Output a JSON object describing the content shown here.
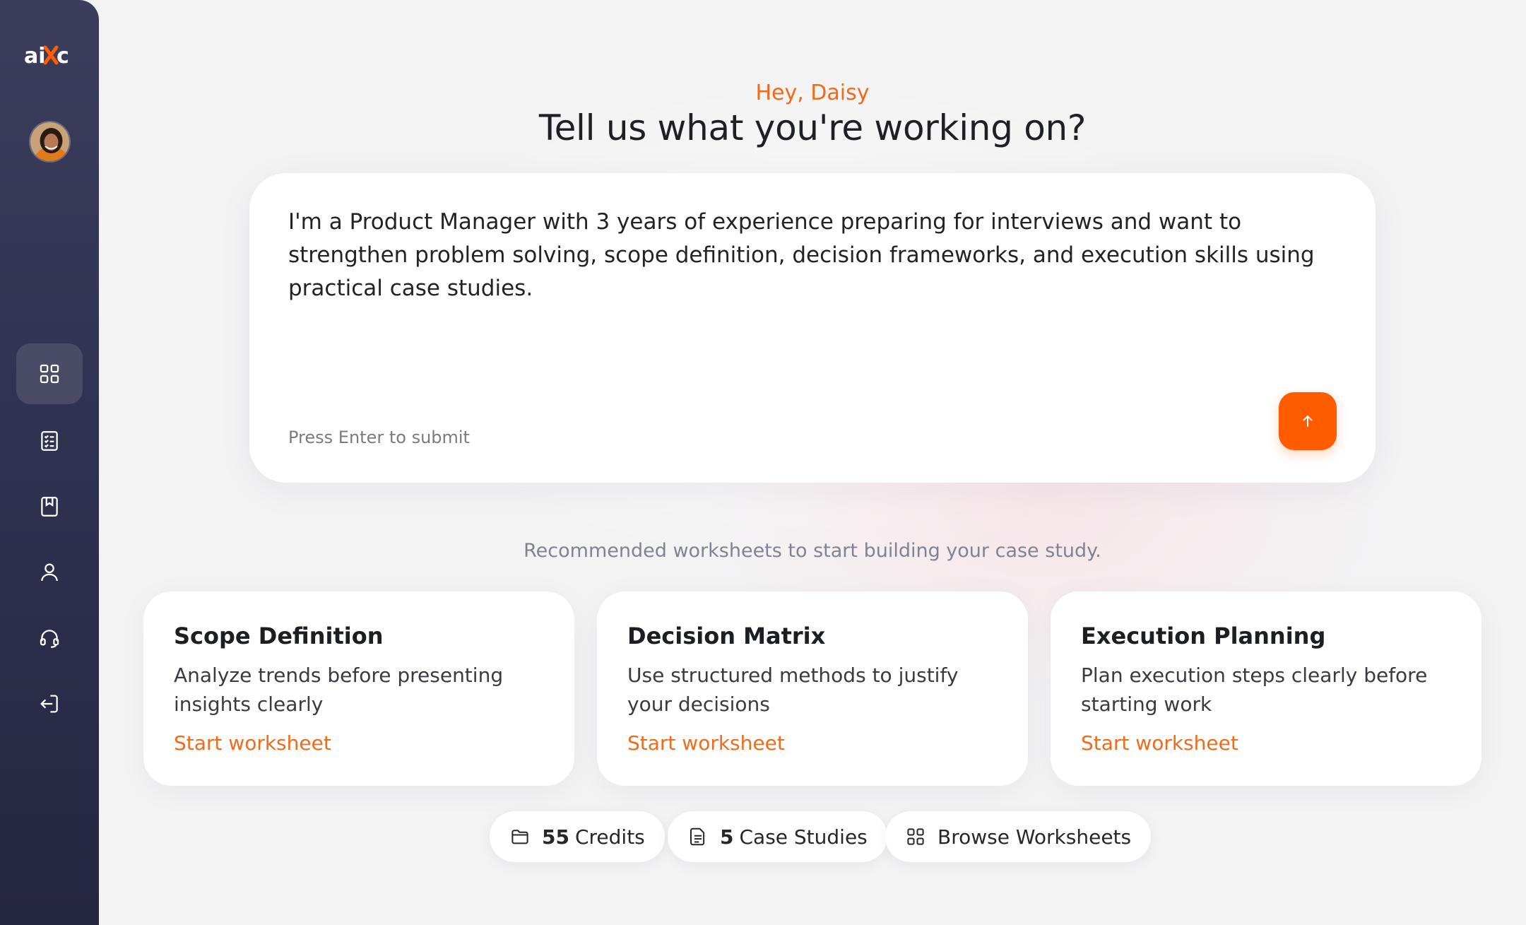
{
  "app": {
    "brand": "aixc"
  },
  "sidebar": {
    "items": [
      {
        "name": "dashboard",
        "icon": "grid-icon",
        "active": true
      },
      {
        "name": "checklist",
        "icon": "checklist-icon",
        "active": false
      },
      {
        "name": "bookmarks",
        "icon": "bookmark-book-icon",
        "active": false
      },
      {
        "name": "profile",
        "icon": "user-icon",
        "active": false
      },
      {
        "name": "support",
        "icon": "headset-icon",
        "active": false
      },
      {
        "name": "logout",
        "icon": "logout-icon",
        "active": false
      }
    ]
  },
  "header": {
    "greeting": "Hey, Daisy",
    "title": "Tell us what you're working on?"
  },
  "prompt": {
    "value": "I'm a Product Manager with 3 years of experience preparing for interviews and want to strengthen problem solving, scope definition, decision frameworks, and execution skills using practical case studies.",
    "hint": "Press Enter to submit",
    "submit_icon": "arrow-up-icon"
  },
  "recommend_text": "Recommended worksheets to start building your case study.",
  "worksheets": [
    {
      "title": "Scope Definition",
      "description": "Analyze trends before presenting insights clearly",
      "link": "Start worksheet"
    },
    {
      "title": "Decision Matrix",
      "description": "Use structured methods to justify your decisions",
      "link": "Start worksheet"
    },
    {
      "title": "Execution Planning",
      "description": "Plan execution steps clearly before starting work",
      "link": "Start worksheet"
    }
  ],
  "stats": {
    "credits": {
      "count": "55",
      "label": "Credits",
      "icon": "folder-icon"
    },
    "case_studies": {
      "count": "5",
      "label": "Case Studies",
      "icon": "document-icon"
    },
    "browse": {
      "label": "Browse Worksheets",
      "icon": "grid-icon"
    }
  },
  "colors": {
    "accent": "#ff5c00",
    "accent_text": "#f26a1b",
    "sidebar": "#2f3150"
  }
}
